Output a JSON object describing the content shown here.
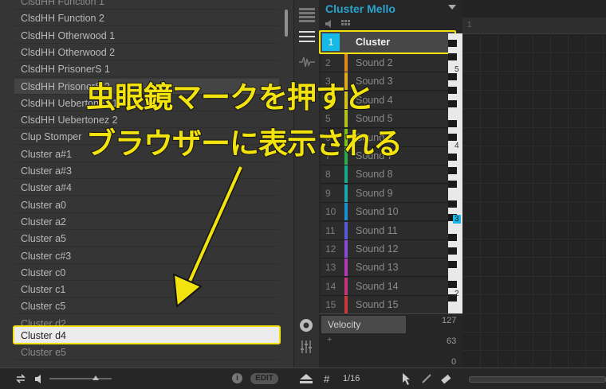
{
  "browser": {
    "items": [
      {
        "label": "ClsdHH Function 1",
        "state": "dim"
      },
      {
        "label": "ClsdHH Function 2",
        "state": "normal"
      },
      {
        "label": "ClsdHH Otherwood 1",
        "state": "normal"
      },
      {
        "label": "ClsdHH Otherwood 2",
        "state": "normal"
      },
      {
        "label": "ClsdHH PrisonerS 1",
        "state": "normal"
      },
      {
        "label": "ClsdHH PrisonerS 2",
        "state": "highlight"
      },
      {
        "label": "ClsdHH Uebertonez 1",
        "state": "normal"
      },
      {
        "label": "ClsdHH Uebertonez 2",
        "state": "normal"
      },
      {
        "label": "Clup Stomper",
        "state": "normal"
      },
      {
        "label": "Cluster a#1",
        "state": "normal"
      },
      {
        "label": "Cluster a#3",
        "state": "normal"
      },
      {
        "label": "Cluster a#4",
        "state": "normal"
      },
      {
        "label": "Cluster a0",
        "state": "normal"
      },
      {
        "label": "Cluster a2",
        "state": "normal"
      },
      {
        "label": "Cluster a5",
        "state": "normal"
      },
      {
        "label": "Cluster c#3",
        "state": "normal"
      },
      {
        "label": "Cluster c0",
        "state": "normal"
      },
      {
        "label": "Cluster c1",
        "state": "normal"
      },
      {
        "label": "Cluster c5",
        "state": "normal"
      },
      {
        "label": "Cluster d2",
        "state": "dim"
      },
      {
        "label": "Cluster d4",
        "state": "selected"
      },
      {
        "label": "Cluster e5",
        "state": "dim"
      }
    ],
    "footer": {
      "edit_label": "EDIT",
      "info_icon": "info-icon"
    }
  },
  "group": {
    "title": "Cluster Mello",
    "sounds": [
      {
        "num": "1",
        "name": "Cluster",
        "color": "#17b9e6"
      },
      {
        "num": "2",
        "name": "Sound 2",
        "color": "#e08a1c"
      },
      {
        "num": "3",
        "name": "Sound 3",
        "color": "#e0a81c"
      },
      {
        "num": "4",
        "name": "Sound 4",
        "color": "#d6c21a"
      },
      {
        "num": "5",
        "name": "Sound 5",
        "color": "#b3c21a"
      },
      {
        "num": "6",
        "name": "Sound 6",
        "color": "#7cc21a"
      },
      {
        "num": "7",
        "name": "Sound 7",
        "color": "#2eaa4a"
      },
      {
        "num": "8",
        "name": "Sound 8",
        "color": "#1aa88a"
      },
      {
        "num": "9",
        "name": "Sound 9",
        "color": "#1aa6b0"
      },
      {
        "num": "10",
        "name": "Sound 10",
        "color": "#1a8fd0"
      },
      {
        "num": "11",
        "name": "Sound 11",
        "color": "#5a5ad6"
      },
      {
        "num": "12",
        "name": "Sound 12",
        "color": "#8a4ad6"
      },
      {
        "num": "13",
        "name": "Sound 13",
        "color": "#b03ab6"
      },
      {
        "num": "14",
        "name": "Sound 14",
        "color": "#c8347a"
      },
      {
        "num": "15",
        "name": "Sound 15",
        "color": "#c83a3a"
      }
    ],
    "key_labels": [
      "5",
      "4",
      "3",
      "2"
    ],
    "grid_marker": "1"
  },
  "velocity": {
    "label": "Velocity",
    "max": "127",
    "mid": "63",
    "min": "0",
    "add": "+"
  },
  "footer": {
    "hash": "#",
    "step": "1/16"
  },
  "annotation": {
    "line1": "虫眼鏡マークを押すと",
    "line2": "ブラウザーに表示される"
  },
  "colors": {
    "highlight_frame": "#f2e20e",
    "accent": "#2aa3ce"
  }
}
